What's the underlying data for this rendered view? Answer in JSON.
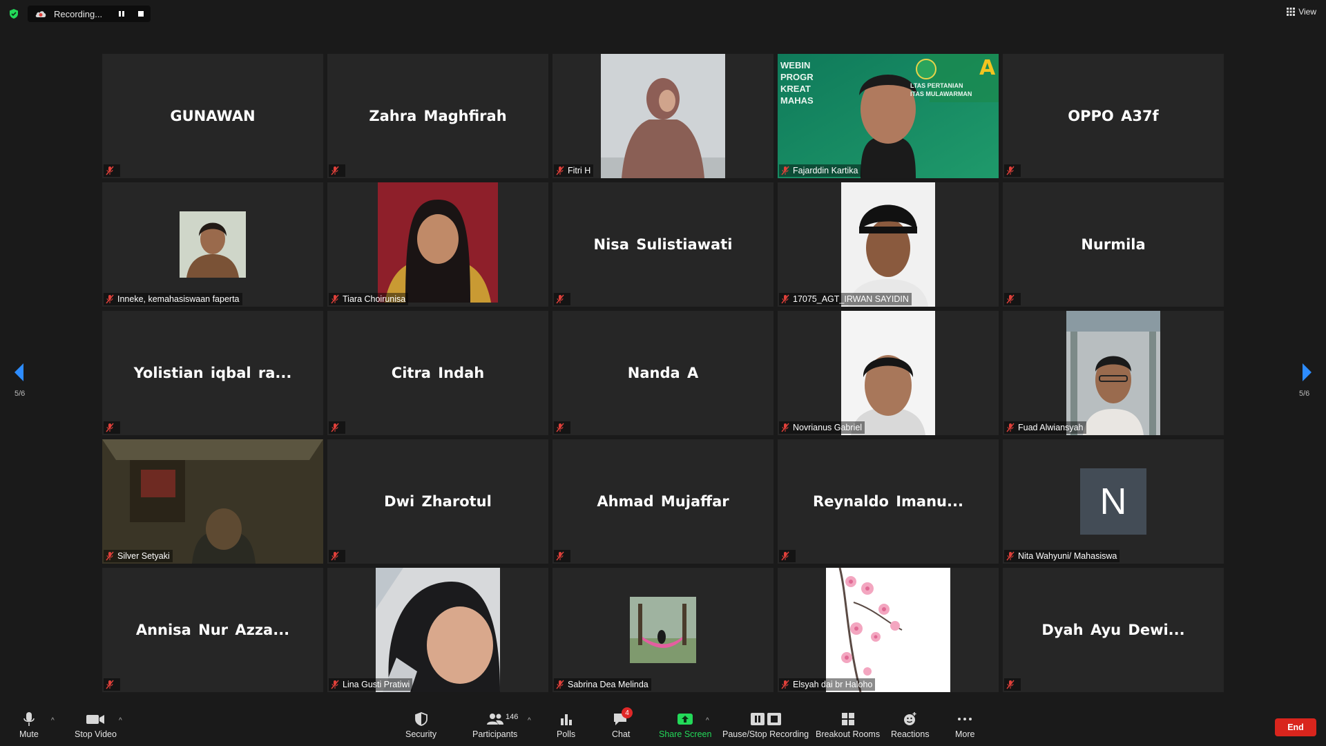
{
  "topbar": {
    "recording_label": "Recording...",
    "view_label": "View"
  },
  "pagination": {
    "left_indicator": "5/6",
    "right_indicator": "5/6"
  },
  "tiles": [
    {
      "name": "GUNAWAN",
      "show": "name"
    },
    {
      "name": "Zahra Maghfirah",
      "show": "name"
    },
    {
      "name": "Fitri H",
      "show": "video",
      "label": "Fitri H"
    },
    {
      "name": "Fajarddin Kartika",
      "show": "video",
      "label": "Fajarddin Kartika"
    },
    {
      "name": "OPPO A37f",
      "show": "name"
    },
    {
      "name": "Inneke, kemahasiswaan faperta",
      "show": "photo",
      "label": "Inneke, kemahasiswaan faperta"
    },
    {
      "name": "Tiara Choirunisa",
      "show": "video",
      "label": "Tiara Choirunisa"
    },
    {
      "name": "Nisa Sulistiawati",
      "show": "name"
    },
    {
      "name": "17075_AGT_IRWAN SAYIDIN",
      "show": "video",
      "label": "17075_AGT_IRWAN SAYIDIN"
    },
    {
      "name": "Nurmila",
      "show": "name"
    },
    {
      "name": "Yolistian iqbal ra...",
      "show": "name"
    },
    {
      "name": "Citra Indah",
      "show": "name"
    },
    {
      "name": "Nanda A",
      "show": "name"
    },
    {
      "name": "Novrianus Gabriel",
      "show": "video",
      "label": "Novrianus Gabriel"
    },
    {
      "name": "Fuad Alwiansyah",
      "show": "video",
      "label": "Fuad Alwiansyah"
    },
    {
      "name": "Silver Setyaki",
      "show": "video",
      "label": "Silver Setyaki"
    },
    {
      "name": "Dwi Zharotul",
      "show": "name"
    },
    {
      "name": "Ahmad Mujaffar",
      "show": "name"
    },
    {
      "name": "Reynaldo  Imanu...",
      "show": "name"
    },
    {
      "name": "Nita Wahyuni/ Mahasiswa",
      "show": "avatar",
      "avatar_letter": "N",
      "label": "Nita Wahyuni/ Mahasiswa"
    },
    {
      "name": "Annisa Nur Azza...",
      "show": "name"
    },
    {
      "name": "Lina Gusti Pratiwi",
      "show": "video",
      "label": "Lina Gusti Pratiwi"
    },
    {
      "name": "Sabrina Dea Melinda",
      "show": "photo",
      "label": "Sabrina Dea Melinda"
    },
    {
      "name": "Elsyah dai br Haloho",
      "show": "video",
      "label": "Elsyah dai br Haloho"
    },
    {
      "name": "Dyah Ayu Dewi...",
      "show": "name"
    }
  ],
  "webinar_banner": {
    "lines": [
      "WEBIN",
      "PROGR",
      "KREAT",
      "MAHAS"
    ],
    "faculty_lines": [
      "LTAS PERTANIAN",
      "ITAS MULAWARMAN"
    ]
  },
  "toolbar": {
    "mute": "Mute",
    "stop_video": "Stop Video",
    "security": "Security",
    "participants": "Participants",
    "participants_count": "146",
    "polls": "Polls",
    "chat": "Chat",
    "chat_badge": "4",
    "share_screen": "Share Screen",
    "pause_stop_recording": "Pause/Stop Recording",
    "breakout_rooms": "Breakout Rooms",
    "reactions": "Reactions",
    "more": "More",
    "end": "End"
  },
  "colors": {
    "background": "#1a1a1a",
    "tile": "#262626",
    "muted_red": "#e0403a",
    "share_green": "#23d959",
    "end_red": "#d9251d",
    "arrow_blue": "#2d8cff",
    "shield_green": "#23d959"
  }
}
